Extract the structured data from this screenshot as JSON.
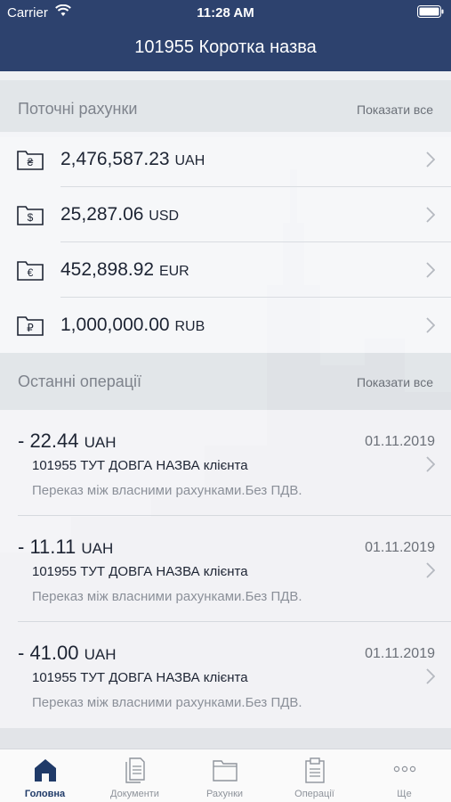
{
  "status_bar": {
    "carrier": "Carrier",
    "time": "11:28 AM"
  },
  "header": {
    "title": "101955 Коротка назва"
  },
  "current_accounts": {
    "title": "Поточні рахунки",
    "show_all": "Показати все",
    "items": [
      {
        "amount": "2,476,587.23",
        "currency": "UAH",
        "icon": "hryvnia-folder-icon",
        "symbol": "₴"
      },
      {
        "amount": "25,287.06",
        "currency": "USD",
        "icon": "dollar-folder-icon",
        "symbol": "$"
      },
      {
        "amount": "452,898.92",
        "currency": "EUR",
        "icon": "euro-folder-icon",
        "symbol": "€"
      },
      {
        "amount": "1,000,000.00",
        "currency": "RUB",
        "icon": "ruble-folder-icon",
        "symbol": "₽"
      }
    ]
  },
  "recent_operations": {
    "title": "Останні операції",
    "show_all": "Показати все",
    "items": [
      {
        "amount": "- 22.44",
        "currency": "UAH",
        "date": "01.11.2019",
        "client": "101955 ТУТ ДОВГА НАЗВА клієнта",
        "description": "Переказ між власними рахунками.Без ПДВ."
      },
      {
        "amount": "- 11.11",
        "currency": "UAH",
        "date": "01.11.2019",
        "client": "101955 ТУТ ДОВГА НАЗВА клієнта",
        "description": "Переказ між власними рахунками.Без ПДВ."
      },
      {
        "amount": "- 41.00",
        "currency": "UAH",
        "date": "01.11.2019",
        "client": "101955 ТУТ ДОВГА НАЗВА клієнта",
        "description": "Переказ між власними рахунками.Без ПДВ."
      }
    ]
  },
  "tab_bar": {
    "items": [
      {
        "label": "Головна",
        "icon": "home-icon",
        "active": true
      },
      {
        "label": "Документи",
        "icon": "documents-icon",
        "active": false
      },
      {
        "label": "Рахунки",
        "icon": "folder-icon",
        "active": false
      },
      {
        "label": "Операції",
        "icon": "clipboard-icon",
        "active": false
      },
      {
        "label": "Ще",
        "icon": "more-icon",
        "active": false
      }
    ]
  },
  "colors": {
    "header_bg": "#2d426e",
    "active_tab": "#1f3a68",
    "inactive_tab": "#8e939b"
  }
}
